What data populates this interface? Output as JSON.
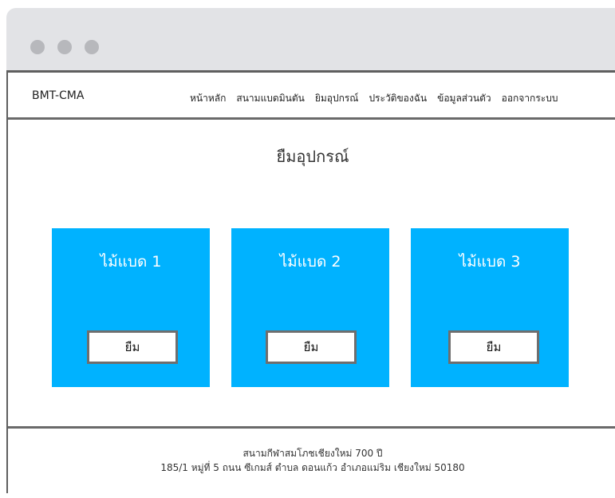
{
  "navbar": {
    "brand": "BMT-CMA",
    "links": [
      "หน้าหลัก",
      "สนามแบดมินตัน",
      "ยิมอุปกรณ์",
      "ประวัติของฉัน",
      "ข้อมูลส่วนตัว",
      "ออกจากระบบ"
    ]
  },
  "main": {
    "title": "ยืมอุปกรณ์",
    "cards": [
      {
        "title": "ไม้แบด 1",
        "button": "ยืม"
      },
      {
        "title": "ไม้แบด 2",
        "button": "ยืม"
      },
      {
        "title": "ไม้แบด 3",
        "button": "ยืม"
      }
    ]
  },
  "footer": {
    "line1": "สนามกีฬาสมโภชเชียงใหม่ 700 ปี",
    "line2": "185/1 หมู่ที่ 5 ถนน ซีเกมส์ ตำบล ดอนแก้ว อำเภอแม่ริม เชียงใหม่ 50180"
  },
  "colors": {
    "card_background": "#00b2ff",
    "chrome_background": "#e2e3e6",
    "border": "#6a6a6a"
  },
  "icons": [
    "window-control-dot",
    "window-control-dot",
    "window-control-dot"
  ]
}
